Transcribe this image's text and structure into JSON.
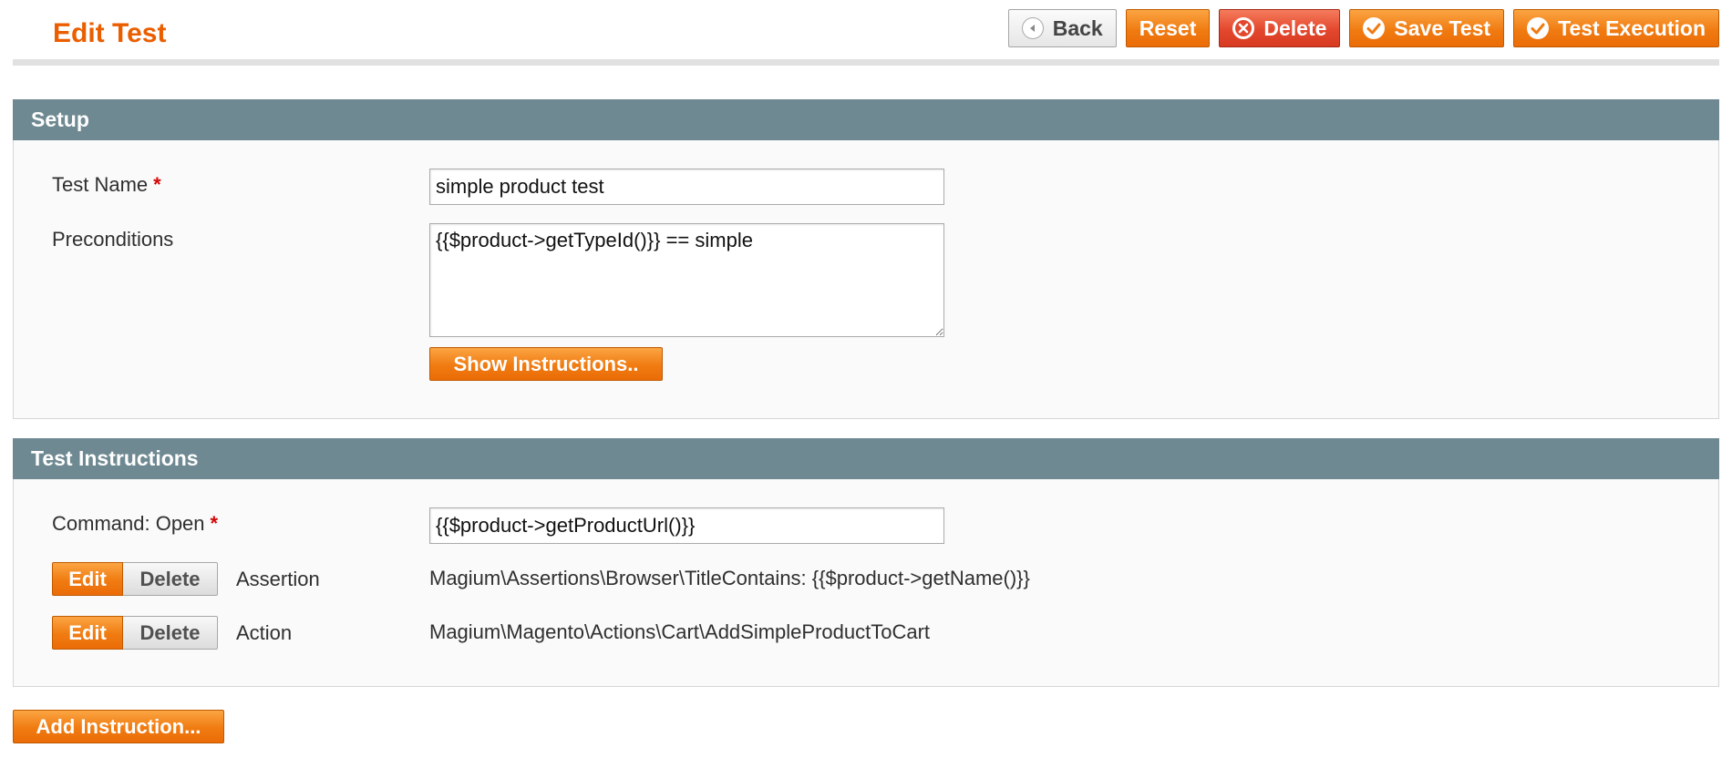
{
  "header": {
    "title": "Edit Test",
    "buttons": {
      "back": "Back",
      "reset": "Reset",
      "delete": "Delete",
      "save": "Save Test",
      "execute": "Test Execution"
    }
  },
  "setup": {
    "heading": "Setup",
    "test_name_label": "Test Name",
    "required_mark": "*",
    "test_name_value": "simple product test",
    "preconditions_label": "Preconditions",
    "preconditions_value": "{{$product->getTypeId()}} == simple",
    "show_instructions_label": "Show Instructions.."
  },
  "instructions": {
    "heading": "Test Instructions",
    "command_label": "Command: Open",
    "required_mark": "*",
    "command_value": "{{$product->getProductUrl()}}",
    "edit_label": "Edit",
    "delete_label": "Delete",
    "rows": [
      {
        "type": "Assertion",
        "value": "Magium\\Assertions\\Browser\\TitleContains: {{$product->getName()}}"
      },
      {
        "type": "Action",
        "value": "Magium\\Magento\\Actions\\Cart\\AddSimpleProductToCart"
      }
    ]
  },
  "footer": {
    "add_instruction_label": "Add Instruction..."
  },
  "colors": {
    "title_orange": "#eb5e00",
    "button_orange": "#f07b11",
    "button_red": "#e3472d",
    "section_header": "#6f8992",
    "required_red": "#d40707"
  }
}
